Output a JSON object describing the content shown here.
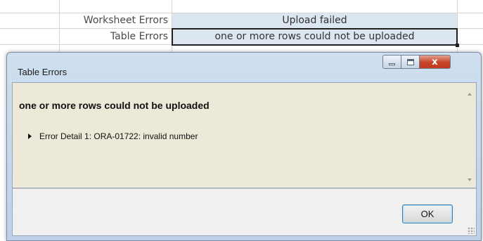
{
  "sheet": {
    "rows": [
      {
        "label": "Worksheet Errors",
        "value": "Upload failed"
      },
      {
        "label": "Table Errors",
        "value": "one or more rows could not be uploaded"
      }
    ]
  },
  "dialog": {
    "title": "Table Errors",
    "message": "one or more rows could not be uploaded",
    "details": [
      {
        "text": "Error Detail 1: ORA-01722: invalid number"
      }
    ],
    "ok_label": "OK",
    "close_glyph": "x"
  },
  "colors": {
    "cell_fill": "#dce6f1",
    "dialog_body": "#ece9d8",
    "close_button": "#c5432a"
  },
  "icons": [
    "minimize-icon",
    "maximize-icon",
    "close-icon",
    "expand-arrow-icon",
    "scroll-up-icon",
    "scroll-down-icon",
    "resize-grip-icon"
  ]
}
